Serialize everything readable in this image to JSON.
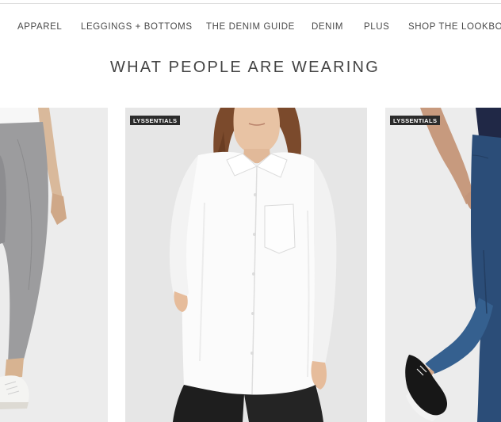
{
  "nav": {
    "items": [
      "APPAREL",
      "LEGGINGS + BOTTOMS",
      "THE DENIM GUIDE",
      "DENIM",
      "PLUS",
      "SHOP THE LOOKBOOK"
    ]
  },
  "section": {
    "title": "WHAT PEOPLE ARE WEARING"
  },
  "products": [
    {
      "badge": "",
      "image": "grey-leggings-white-sneakers"
    },
    {
      "badge": "LYSSENTIALS",
      "image": "white-button-down-shirt"
    },
    {
      "badge": "LYSSENTIALS",
      "image": "blue-denim-leggings-black-sneakers"
    }
  ],
  "colors": {
    "nav_text": "#4a4a4a",
    "title_text": "#444444",
    "badge_bg": "#2b2b2b",
    "card_bg": "#ebebeb"
  }
}
